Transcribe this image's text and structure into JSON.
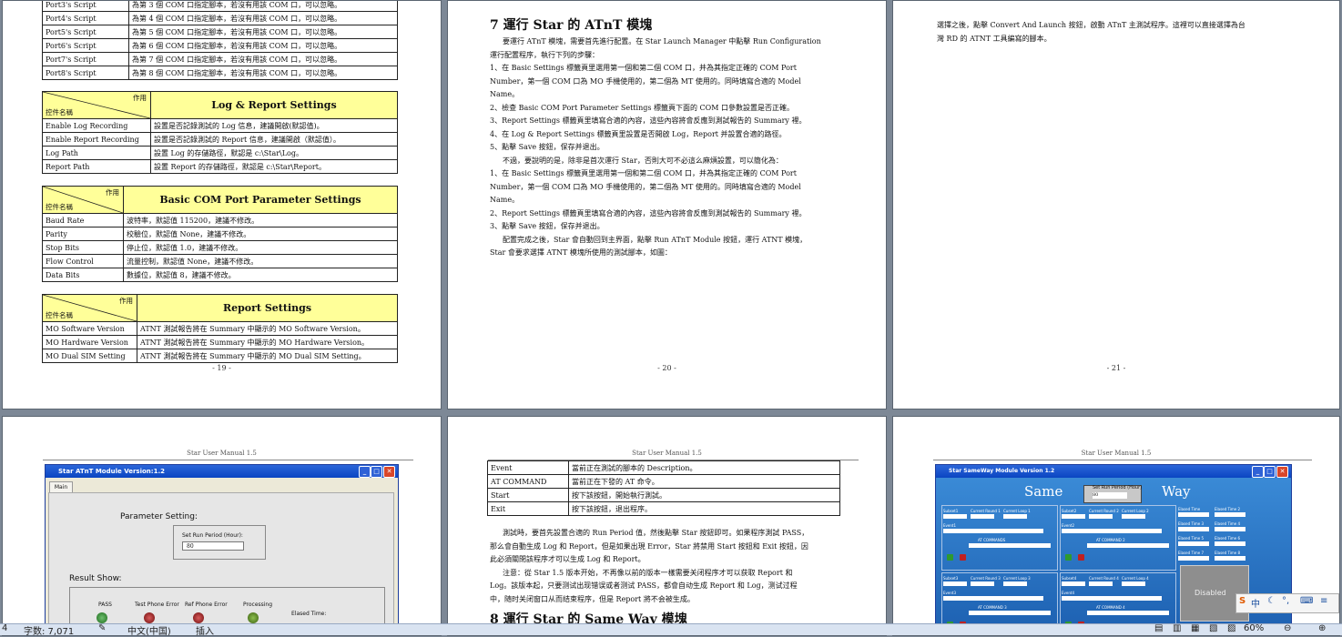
{
  "page1": {
    "script_rows": [
      [
        "Port3's Script",
        "為第 3 個 COM 口指定腳本，若沒有用該 COM 口，可以忽略。"
      ],
      [
        "Port4's Script",
        "為第 4 個 COM 口指定腳本，若沒有用該 COM 口，可以忽略。"
      ],
      [
        "Port5's Script",
        "為第 5 個 COM 口指定腳本，若沒有用該 COM 口，可以忽略。"
      ],
      [
        "Port6's Script",
        "為第 6 個 COM 口指定腳本，若沒有用該 COM 口，可以忽略。"
      ],
      [
        "Port7's Script",
        "為第 7 個 COM 口指定腳本，若沒有用該 COM 口，可以忽略。"
      ],
      [
        "Port8's Script",
        "為第 8 個 COM 口指定腳本，若沒有用該 COM 口，可以忽略。"
      ]
    ],
    "diag_top": "作用",
    "diag_bottom": "控件名稱",
    "log_title": "Log & Report Settings",
    "log_rows": [
      [
        "Enable Log Recording",
        "設置是否記錄測試的 Log 信息，建議開啟(默認值)。"
      ],
      [
        "Enable Report Recording",
        "設置是否記錄測試的 Report 信息，建議開啟（默認值）。"
      ],
      [
        "Log Path",
        "設置 Log 的存儲路徑，默認是 c:\\Star\\Log。"
      ],
      [
        "Report Path",
        "設置 Report 的存儲路徑，默認是 c:\\Star\\Report。"
      ]
    ],
    "com_title": "Basic COM Port Parameter Settings",
    "com_rows": [
      [
        "Baud Rate",
        "波特率，默認值 115200，建議不修改。"
      ],
      [
        "Parity",
        "校驗位，默認值 None，建議不修改。"
      ],
      [
        "Stop Bits",
        "停止位，默認值 1.0，建議不修改。"
      ],
      [
        "Flow Control",
        "流量控制，默認值 None，建議不修改。"
      ],
      [
        "Data Bits",
        "數據位，默認值 8，建議不修改。"
      ]
    ],
    "report_title": "Report Settings",
    "report_rows": [
      [
        "MO Software Version",
        "ATNT 測試報告將在 Summary 中顯示的 MO Software Version。"
      ],
      [
        "MO Hardware Version",
        "ATNT 測試報告將在 Summary 中顯示的 MO Hardware Version。"
      ],
      [
        "MO Dual SIM Setting",
        "ATNT 測試報告將在 Summary 中顯示的 MO Dual SIM Setting。"
      ]
    ],
    "page_num": "- 19 -"
  },
  "page2": {
    "heading": "7  運行 Star 的 ATnT 模塊",
    "lines": [
      "要運行 ATnT 模塊，需要首先進行配置。在 Star Launch Manager 中點擊 Run Configuration",
      "運行配置程序，執行下列的步驟：",
      "1、在 Basic Settings 標籤頁里選用第一個和第二個 COM 口，并為其指定正確的 COM Port",
      "Number，第一個 COM 口為 MO 手機使用的，第二個為 MT 使用的。同時填寫合適的 Model",
      "Name。",
      "2、檢查 Basic COM Port Parameter Settings 標籤頁下面的 COM 口參數設置是否正確。",
      "3、Report Settings 標籤頁里填寫合適的內容，這些內容將會反應到測試報告的 Summary 裡。",
      "4、在 Log & Report Settings 標籤頁里設置是否開啟 Log，Report 并設置合適的路徑。",
      "5、點擊 Save 按鈕，保存并退出。",
      "不過，要說明的是，除非是首次運行 Star，否則大可不必這么麻煩設置，可以簡化為：",
      "1、在 Basic Settings 標籤頁里選用第一個和第二個 COM 口，并為其指定正確的 COM Port",
      "Number，第一個 COM 口為 MO 手機使用的，第二個為 MT 使用的。同時填寫合適的 Model",
      "Name。",
      "2、Report Settings 標籤頁里填寫合適的內容，這些內容將會反應到測試報告的 Summary 裡。",
      "3、點擊 Save 按鈕，保存并退出。",
      "配置完成之後，Star 會自動回到主界面，點擊 Run ATnT Module 按鈕，運行 ATNT 模塊，",
      "Star 會要求選擇 ATNT 模塊所使用的測試腳本，如圖："
    ],
    "page_num": "- 20 -"
  },
  "page3": {
    "lines": [
      "選擇之後，點擊 Convert And Launch 按鈕，啟動 ATnT 主測試程序。這裡可以直接選擇為台",
      "灣 RD 的 ATNT 工具編寫的腳本。"
    ],
    "page_num": "- 21 -"
  },
  "page4": {
    "header": "Star User Manual 1.5",
    "window_title": "Star ATnT Module Version:1.2",
    "tab": "Main",
    "param_label": "Parameter Setting:",
    "period_label": "Set Run Period (Hour):",
    "period_value": "80",
    "result_label": "Result Show:",
    "pass_label": "PASS",
    "tpe_label": "Test Phone Error",
    "rpe_label": "Ref Phone Error",
    "proc_label": "Processing",
    "elapsed_label": "Elased Time:"
  },
  "page5": {
    "header": "Star User Manual 1.5",
    "rows": [
      [
        "Event",
        "當前正在測試的腳本的 Description。"
      ],
      [
        "AT COMMAND",
        "當前正在下發的 AT 命令。"
      ],
      [
        "Start",
        "按下該按鈕，開始執行測試。"
      ],
      [
        "Exit",
        "按下該按鈕，退出程序。"
      ]
    ],
    "lines": [
      "測試時，要首先設置合適的 Run Period 值，然後點擊 Star 按鈕即可。如果程序測試 PASS，",
      "那么會自動生成 Log 和 Report，但是如果出現 Error，Star 將禁用 Start 按鈕和 Exit 按鈕，因",
      "此必須關閉該程序才可以生成 Log 和 Report。",
      "注意：從 Star 1.5 版本开始，不再像以前的版本一樣需要关闭程序才可以获取 Report 和",
      "Log。該版本起，只要测试出现错误或者测试 PASS，都會自动生成 Report 和 Log，测试过程",
      "中，随时关闭窗口从而结束程序，但是 Report 將不会被生成。"
    ],
    "heading": "8  運行 Star 的 Same Way 模塊"
  },
  "page6": {
    "header": "Star User Manual 1.5",
    "window_title": "Star SameWay Module   Version 1.2",
    "title_left": "Same",
    "title_right": "Way",
    "period_label": "Set Run Period (Hour)",
    "period_value": "80",
    "at_label": "AT COMMANDS",
    "disabled": "Disabled",
    "panel1_labels": [
      "Subset1",
      "Current Round 1",
      "Current Loop 1",
      "Event1"
    ],
    "panel2_labels": [
      "Subset2",
      "Current Round 2",
      "Current Loop 2",
      "Event2"
    ],
    "panel3_labels": [
      "Subset3",
      "Current Round 3",
      "Current Loop 3",
      "Event3"
    ],
    "panel4_labels": [
      "Subset4",
      "Current Round 4",
      "Current Loop 4",
      "Event4"
    ],
    "elapsed": [
      "Elased Time",
      "Elased Time 2",
      "Elased Time 3",
      "Elased Time 4",
      "Elased Time 5",
      "Elased Time 6",
      "Elased Time 7",
      "Elased Time 8"
    ],
    "at1": "AT COMMANDS",
    "at2": "AT COMMAND 2",
    "at3": "AT COMMAND 3",
    "at4": "AT COMMAND 4"
  },
  "status": {
    "page_frag": "4",
    "word_count": "字数: 7,071",
    "language": "中文(中国)",
    "mode": "插入",
    "zoom": "60%"
  },
  "ime": {
    "s": "S",
    "lang": "中"
  }
}
